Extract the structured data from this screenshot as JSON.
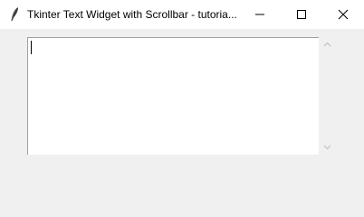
{
  "window": {
    "title": "Tkinter Text Widget with Scrollbar - tutoria...",
    "icon": "feather-icon",
    "controls": [
      "minimize-icon",
      "maximize-icon",
      "close-icon"
    ]
  },
  "text_widget": {
    "value": ""
  },
  "scrollbar": {
    "up_icon": "chevron-up-icon",
    "down_icon": "chevron-down-icon"
  },
  "colors": {
    "window_bg": "#f0f0f0",
    "titlebar_bg": "#ffffff",
    "text_bg": "#ffffff",
    "border": "#a0a0a0",
    "arrow": "#c0c0c0"
  }
}
